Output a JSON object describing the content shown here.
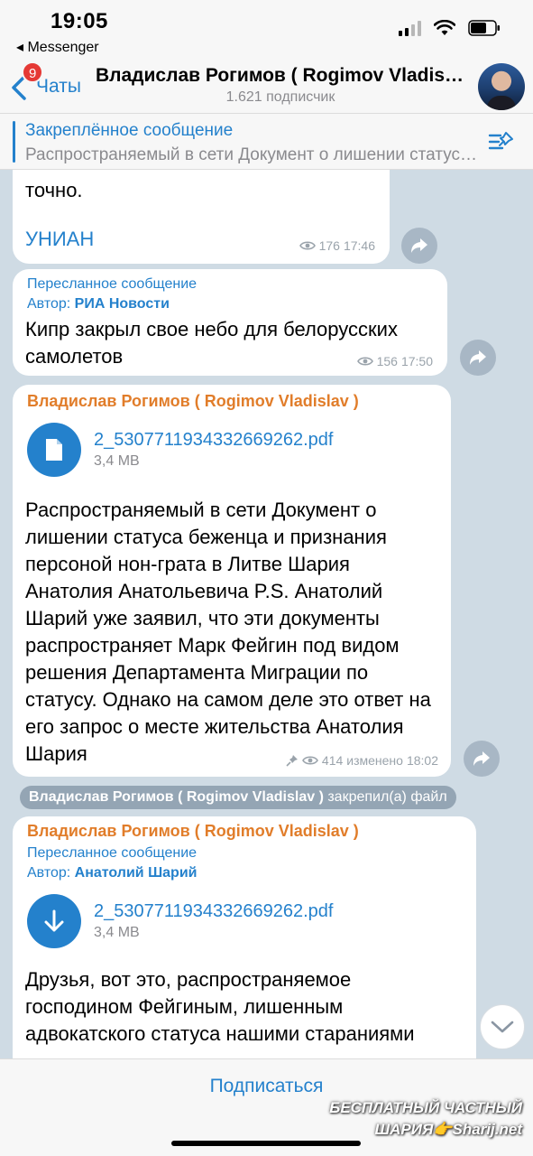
{
  "status_bar": {
    "time": "19:05",
    "back_app": "◂ Messenger"
  },
  "nav": {
    "back_label": "Чаты",
    "badge": "9",
    "title": "Владислав Рогимов ( Rogimov Vladislav )",
    "subtitle": "1.621 подписчик"
  },
  "pinned": {
    "title": "Закреплённое сообщение",
    "text": "Распространяемый в сети Документ о лишении статуса беженца и признания персоной нон-грата"
  },
  "messages": [
    {
      "text": "точно.",
      "link": "УНИАН",
      "views": "176",
      "time": "17:46"
    },
    {
      "forward_label": "Пересланное сообщение",
      "author_label": "Автор:",
      "author": "РИА Новости",
      "text": "Кипр закрыл свое небо для белорусских самолетов",
      "views": "156",
      "time": "17:50"
    },
    {
      "sender": "Владислав Рогимов ( Rogimov Vladislav )",
      "file_name": "2_5307711934332669262.pdf",
      "file_size": "3,4 MB",
      "text": "Распространяемый в сети Документ о лишении статуса беженца и признания персоной нон-грата в Литве Шария Анатолия Анатольевича P.S. Анатолий Шарий уже заявил, что эти документы распространяет Марк Фейгин под видом решения Департамента Миграции по статусу. Однако на самом деле это ответ на его запрос о месте жительства Анатолия Шария",
      "views": "414",
      "edited": "изменено",
      "time": "18:02"
    },
    {
      "sender": "Владислав Рогимов ( Rogimov Vladislav )",
      "forward_label": "Пересланное сообщение",
      "author_label": "Автор:",
      "author": "Анатолий Шарий",
      "file_name": "2_5307711934332669262.pdf",
      "file_size": "3,4 MB",
      "text": "Друзья, вот это, распространяемое господином Фейгиным, лишенным адвокатского статуса нашими стараниями"
    }
  ],
  "service_message": {
    "name": "Владислав Рогимов ( Rogimov Vladislav )",
    "action": "закрепил(а) файл"
  },
  "bottom": {
    "subscribe": "Подписаться"
  },
  "watermark": {
    "line1": "БЕСПЛАТНЫЙ ЧАСТНЫЙ",
    "line2": "ШАРИЯ👉Sharij.net"
  },
  "icons": [
    "back-chevron-icon",
    "pin-list-icon",
    "eye-icon",
    "share-icon",
    "document-icon",
    "download-arrow-icon",
    "pin-icon",
    "chevron-down-icon",
    "signal-icon",
    "wifi-icon",
    "battery-icon"
  ],
  "colors": {
    "accent": "#2481cc",
    "sender": "#e17d2a",
    "badge": "#e53935",
    "chat_bg": "#cfdbe4"
  }
}
